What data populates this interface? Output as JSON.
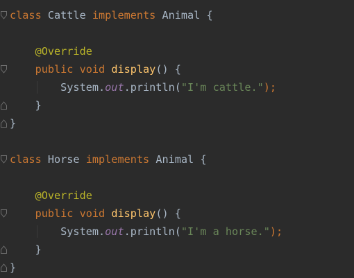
{
  "editor": {
    "theme_colors": {
      "background": "#2b2b2b",
      "keyword": "#cc7832",
      "annotation": "#bbb529",
      "method": "#ffc66d",
      "field": "#9876aa",
      "string": "#6a8759",
      "plain": "#a9b7c6"
    },
    "lines": [
      {
        "tokens": [
          {
            "t": "class",
            "c": "kw"
          },
          {
            "t": " Cattle ",
            "c": "plain"
          },
          {
            "t": "implements",
            "c": "kw"
          },
          {
            "t": " Animal {",
            "c": "plain"
          }
        ]
      },
      {
        "tokens": []
      },
      {
        "tokens": [
          {
            "t": "    @Override",
            "c": "ann"
          }
        ]
      },
      {
        "tokens": [
          {
            "t": "    public void ",
            "c": "kw"
          },
          {
            "t": "display",
            "c": "fn"
          },
          {
            "t": "() {",
            "c": "plain"
          }
        ]
      },
      {
        "tokens": [
          {
            "t": "        System.",
            "c": "plain"
          },
          {
            "t": "out",
            "c": "field"
          },
          {
            "t": ".println(",
            "c": "plain"
          },
          {
            "t": "\"I'm cattle.\"",
            "c": "str"
          },
          {
            "t": ");",
            "c": "kw"
          }
        ]
      },
      {
        "tokens": [
          {
            "t": "    }",
            "c": "plain"
          }
        ]
      },
      {
        "tokens": [
          {
            "t": "}",
            "c": "plain"
          }
        ]
      },
      {
        "tokens": []
      },
      {
        "tokens": [
          {
            "t": "class",
            "c": "kw"
          },
          {
            "t": " Horse ",
            "c": "plain"
          },
          {
            "t": "implements",
            "c": "kw"
          },
          {
            "t": " Animal {",
            "c": "plain"
          }
        ]
      },
      {
        "tokens": []
      },
      {
        "tokens": [
          {
            "t": "    @Override",
            "c": "ann"
          }
        ]
      },
      {
        "tokens": [
          {
            "t": "    public void ",
            "c": "kw"
          },
          {
            "t": "display",
            "c": "fn"
          },
          {
            "t": "() {",
            "c": "plain"
          }
        ]
      },
      {
        "tokens": [
          {
            "t": "        System.",
            "c": "plain"
          },
          {
            "t": "out",
            "c": "field"
          },
          {
            "t": ".println(",
            "c": "plain"
          },
          {
            "t": "\"I'm a horse.\"",
            "c": "str"
          },
          {
            "t": ");",
            "c": "kw"
          }
        ]
      },
      {
        "tokens": [
          {
            "t": "    }",
            "c": "plain"
          }
        ]
      },
      {
        "tokens": [
          {
            "t": "}",
            "c": "plain"
          }
        ]
      }
    ],
    "fold_markers": [
      {
        "line": 0,
        "icon": "fold-open-icon"
      },
      {
        "line": 3,
        "icon": "fold-open-icon"
      },
      {
        "line": 5,
        "icon": "fold-close-icon"
      },
      {
        "line": 6,
        "icon": "fold-close-icon"
      },
      {
        "line": 8,
        "icon": "fold-open-icon"
      },
      {
        "line": 11,
        "icon": "fold-open-icon"
      },
      {
        "line": 13,
        "icon": "fold-close-icon"
      },
      {
        "line": 14,
        "icon": "fold-close-icon"
      }
    ]
  }
}
